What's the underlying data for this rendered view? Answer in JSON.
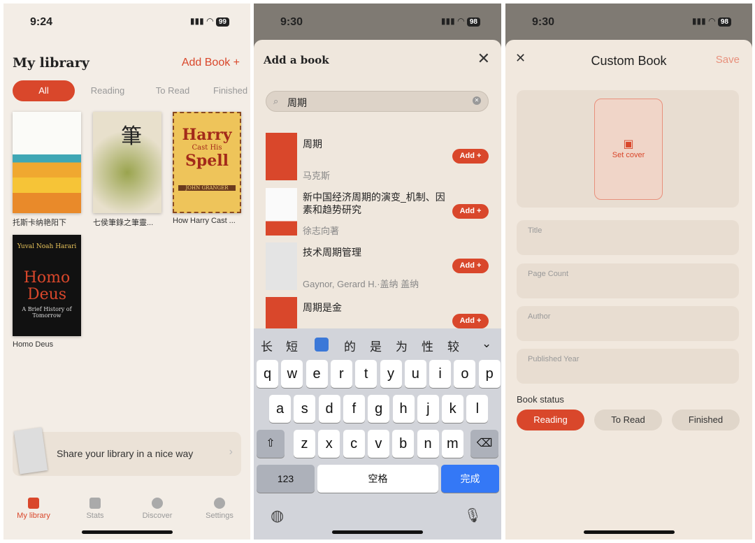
{
  "colors": {
    "accent": "#d9472b",
    "background": "#f3ede6"
  },
  "library": {
    "status": {
      "time": "9:24",
      "battery": "99"
    },
    "title": "My library",
    "add_book": "Add Book +",
    "filters": [
      {
        "label": "All",
        "active": true
      },
      {
        "label": "Reading"
      },
      {
        "label": "To Read"
      },
      {
        "label": "Finished"
      }
    ],
    "books": [
      {
        "title": "托斯卡纳艳阳下"
      },
      {
        "title": "七侯筆錄之筆靈..."
      },
      {
        "title": "How Harry Cast ..."
      },
      {
        "title": "Homo Deus",
        "cover_lines": [
          "Yuval Noah Harari",
          "Homo",
          "Deus",
          "A Brief History of Tomorrow"
        ]
      }
    ],
    "harry_cover": [
      "Harry",
      "Cast His",
      "Spell",
      "JOHN GRANGER"
    ],
    "share": {
      "label": "Share your library in a nice way",
      "icon": "chevron-right"
    },
    "tabs": [
      {
        "label": "My library",
        "icon": "book",
        "active": true
      },
      {
        "label": "Stats",
        "icon": "bar-chart"
      },
      {
        "label": "Discover",
        "icon": "compass"
      },
      {
        "label": "Settings",
        "icon": "gear"
      }
    ]
  },
  "add": {
    "status": {
      "time": "9:30",
      "battery": "98"
    },
    "title": "Add a book",
    "search_value": "周期",
    "results": [
      {
        "title": "周期",
        "author": "马克斯",
        "add": "Add +"
      },
      {
        "title": "新中国经济周期的演变_机制、因素和趋势研究",
        "author": "徐志向著",
        "add": "Add +"
      },
      {
        "title": "技术周期管理",
        "author": "Gaynor, Gerard H.·盖纳 盖纳",
        "add": "Add +"
      },
      {
        "title": "周期是金",
        "author": "",
        "add": "Add +"
      }
    ],
    "candidates": [
      "长",
      "短",
      "的",
      "是",
      "为",
      "性",
      "较"
    ],
    "rows": [
      [
        "q",
        "w",
        "e",
        "r",
        "t",
        "y",
        "u",
        "i",
        "o",
        "p"
      ],
      [
        "a",
        "s",
        "d",
        "f",
        "g",
        "h",
        "j",
        "k",
        "l"
      ],
      [
        "z",
        "x",
        "c",
        "v",
        "b",
        "n",
        "m"
      ]
    ],
    "key_123": "123",
    "key_space": "空格",
    "key_done": "完成"
  },
  "custom": {
    "status": {
      "time": "9:30",
      "battery": "98"
    },
    "title": "Custom Book",
    "save": "Save",
    "set_cover": "Set cover",
    "fields": [
      "Title",
      "Page Count",
      "Author",
      "Published Year"
    ],
    "status_label": "Book status",
    "statuses": [
      {
        "label": "Reading",
        "active": true
      },
      {
        "label": "To Read"
      },
      {
        "label": "Finished"
      }
    ]
  }
}
